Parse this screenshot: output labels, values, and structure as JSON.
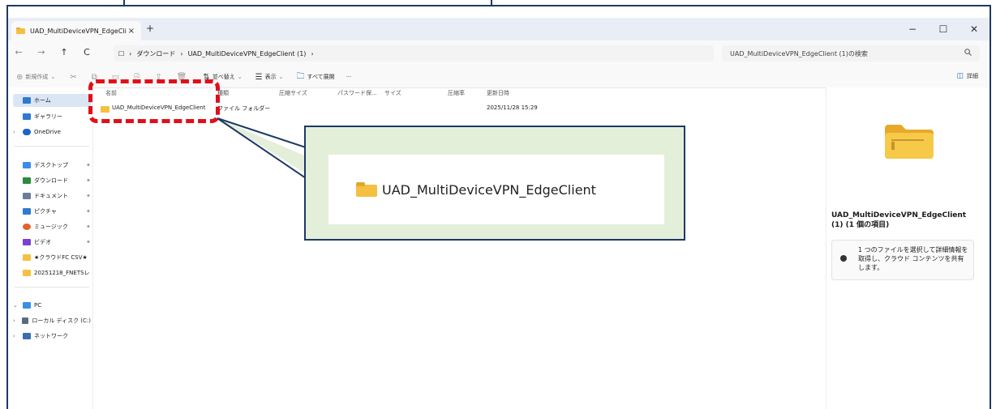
{
  "window": {
    "tab_title": "UAD_MultiDeviceVPN_EdgeCli",
    "tab_close": "×",
    "new_tab": "+",
    "controls": {
      "minimize": "−",
      "maximize": "☐",
      "close": "✕"
    }
  },
  "nav": {
    "back": "←",
    "forward": "→",
    "up": "↑",
    "refresh": "C"
  },
  "address": {
    "monitor_icon": "☐",
    "separator": "›",
    "crumbs": [
      "ダウンロード",
      "UAD_MultiDeviceVPN_EdgeClient (1)"
    ],
    "trailing": "›"
  },
  "search": {
    "placeholder": "UAD_MultiDeviceVPN_EdgeClient (1)の検索",
    "icon": "search-icon"
  },
  "commandbar": {
    "new_label": "新規作成",
    "sort_label": "並べ替え",
    "view_label": "表示",
    "extract_label": "すべて展開",
    "more_label": "···",
    "details_label": "詳細"
  },
  "sidebar": {
    "items": [
      {
        "label": "ホーム",
        "color": "#2f7ad1"
      },
      {
        "label": "ギャラリー",
        "color": "#2f7ad1"
      },
      {
        "label": "OneDrive",
        "color": "#1e63c7"
      },
      {
        "label": "デスクトップ",
        "color": "#3a8ee6"
      },
      {
        "label": "ダウンロード",
        "color": "#2b8a3e"
      },
      {
        "label": "ドキュメント",
        "color": "#6b7d99"
      },
      {
        "label": "ピクチャ",
        "color": "#2f7ad1"
      },
      {
        "label": "ミュージック",
        "color": "#e0632f"
      },
      {
        "label": "ビデオ",
        "color": "#7b3fd1"
      },
      {
        "label": "★クラウドFC CSV★",
        "color": "#f5c042"
      },
      {
        "label": "20251218_FNETSレ",
        "color": "#f5c042"
      },
      {
        "label": "PC",
        "color": "#3a8ee6"
      },
      {
        "label": "ローカル ディスク (C:)",
        "color": "#5b6b7f"
      },
      {
        "label": "ネットワーク",
        "color": "#3a6fb0"
      }
    ],
    "pin": "📌"
  },
  "list": {
    "headers": [
      "名前",
      "種類",
      "圧縮サイズ",
      "パスワード保...",
      "サイズ",
      "圧縮率",
      "更新日時"
    ],
    "rows": [
      {
        "name": "UAD_MultiDeviceVPN_EdgeClient",
        "type": "ファイル フォルダー",
        "date": "2025/11/28 15:29"
      }
    ]
  },
  "preview": {
    "title": "UAD_MultiDeviceVPN_EdgeClient (1) (1 個の項目)",
    "message": "1 つのファイルを選択して詳細情報を取得し、クラウド コンテンツを共有します。"
  },
  "annotation": {
    "callout_text": "UAD_MultiDeviceVPN_EdgeClient",
    "highlight_color": "#e0101a",
    "callout_bg": "#e4efda",
    "border_color": "#1f3864"
  }
}
